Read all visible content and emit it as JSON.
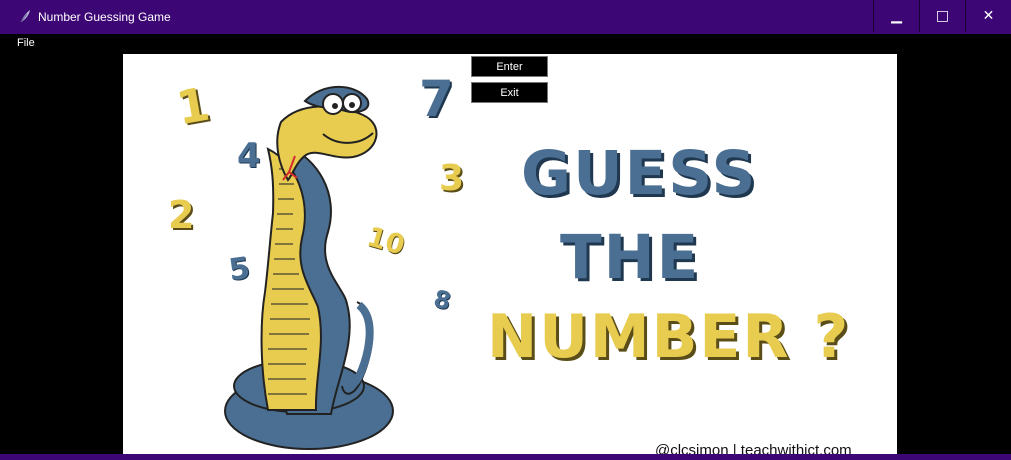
{
  "window": {
    "title": "Number Guessing Game",
    "controls": {
      "minimize": "▁",
      "maximize": "□",
      "close": "✕"
    }
  },
  "menu": {
    "file": "File"
  },
  "buttons": {
    "enter": "Enter",
    "exit": "Exit"
  },
  "illustration": {
    "headline": [
      "GUESS",
      "THE",
      "NUMBER ?"
    ],
    "numbers": [
      "1",
      "7",
      "4",
      "3",
      "2",
      "10",
      "5",
      "8"
    ],
    "credit": "@clcsimon | teachwithict.com"
  },
  "colors": {
    "titlebar": "#3c0774",
    "blue": "#4a6f92",
    "yellow": "#e8cc4f"
  }
}
